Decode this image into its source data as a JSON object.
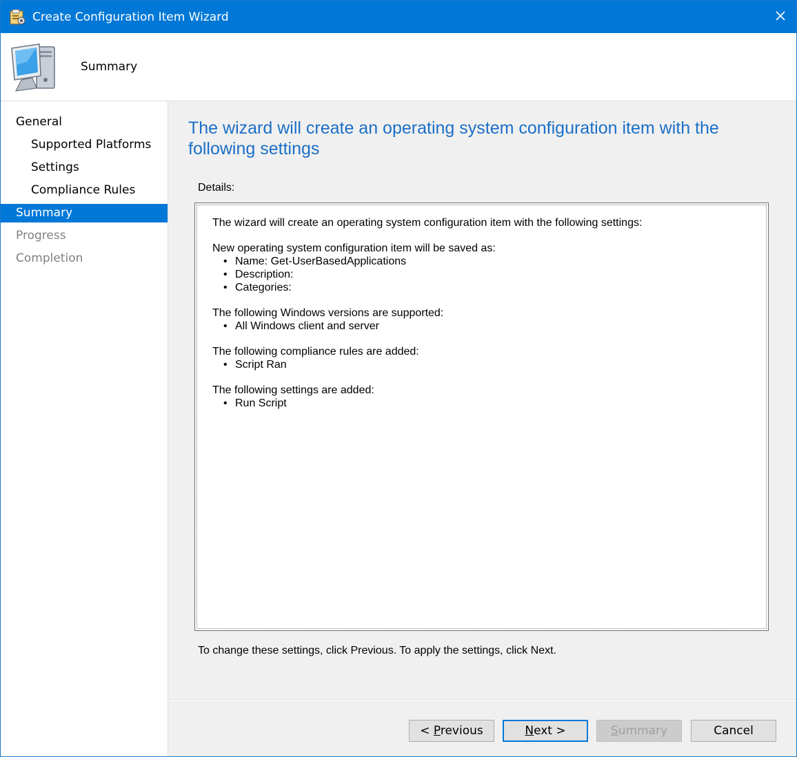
{
  "window": {
    "title": "Create Configuration Item Wizard",
    "accent_color": "#0078d7",
    "title_icon": "configuration-item-icon",
    "close_icon": "close-icon"
  },
  "header": {
    "title": "Summary",
    "icon": "computer-icon"
  },
  "sidebar": {
    "items": [
      {
        "label": "General",
        "level": "top",
        "state": "normal"
      },
      {
        "label": "Supported Platforms",
        "level": "sub",
        "state": "normal"
      },
      {
        "label": "Settings",
        "level": "sub",
        "state": "normal"
      },
      {
        "label": "Compliance Rules",
        "level": "sub",
        "state": "normal"
      },
      {
        "label": "Summary",
        "level": "top",
        "state": "active"
      },
      {
        "label": "Progress",
        "level": "top",
        "state": "disabled"
      },
      {
        "label": "Completion",
        "level": "top",
        "state": "disabled"
      }
    ]
  },
  "main": {
    "heading": "The wizard will create an operating system configuration item with the following settings",
    "details_label": "Details:",
    "details": {
      "intro": "The wizard will create an operating system configuration item with the following settings:",
      "sections": [
        {
          "title": "New operating system configuration item will be saved as:",
          "bullets": [
            "Name: Get-UserBasedApplications",
            "Description:",
            "Categories:"
          ]
        },
        {
          "title": "The following Windows versions are supported:",
          "bullets": [
            "All Windows client and server"
          ]
        },
        {
          "title": "The following compliance rules are added:",
          "bullets": [
            "Script Ran"
          ]
        },
        {
          "title": "The following settings are added:",
          "bullets": [
            "Run Script"
          ]
        }
      ]
    },
    "hint": "To change these settings, click Previous. To apply the settings, click Next."
  },
  "buttons": {
    "previous": {
      "before": "< ",
      "mnemonic": "P",
      "after": "revious"
    },
    "next": {
      "before": "",
      "mnemonic": "N",
      "after": "ext >"
    },
    "summary": {
      "before": "",
      "mnemonic": "S",
      "after": "ummary",
      "state": "disabled"
    },
    "cancel": {
      "label": "Cancel"
    }
  }
}
